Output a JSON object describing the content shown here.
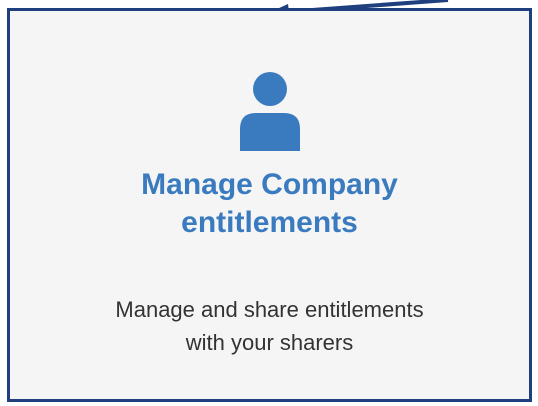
{
  "card": {
    "icon": "user-icon",
    "title_line1": "Manage Company",
    "title_line2": "entitlements",
    "description_line1": "Manage and share entitlements",
    "description_line2": "with your sharers"
  },
  "colors": {
    "accent": "#3a7bbf",
    "border": "#1f3f7f",
    "card_background": "#f5f5f5",
    "text": "#333333"
  }
}
